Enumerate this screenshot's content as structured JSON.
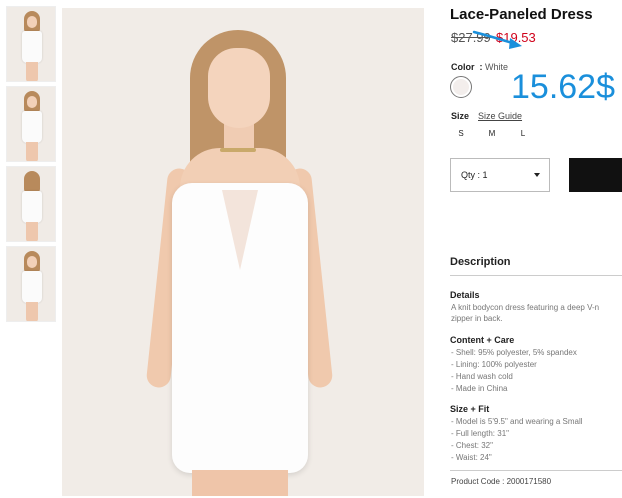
{
  "product": {
    "title": "Lace-Paneled Dress",
    "price_old": "$27.99",
    "price_new": "$19.53",
    "annotation_price": "15.62$",
    "annotation_color": "#1a8fdb"
  },
  "color": {
    "label": "Color",
    "separator": ":",
    "value": "White"
  },
  "size": {
    "label": "Size",
    "guide_link": "Size Guide",
    "options": [
      "S",
      "M",
      "L"
    ]
  },
  "quantity": {
    "label": "Qty : 1"
  },
  "description": {
    "title": "Description",
    "details_heading": "Details",
    "details_lines": [
      "A knit bodycon dress featuring a deep V-n",
      "zipper in back."
    ],
    "content_heading": "Content + Care",
    "content_lines": [
      "- Shell: 95% polyester, 5% spandex",
      "- Lining: 100% polyester",
      "- Hand wash cold",
      "- Made in China"
    ],
    "size_fit_heading": "Size + Fit",
    "size_fit_lines": [
      "- Model is 5'9.5\" and wearing a Small",
      "- Full length: 31\"",
      "- Chest: 32\"",
      "- Waist: 24\""
    ],
    "product_code": "Product Code : 2000171580"
  },
  "thumbnails": [
    {
      "icon": "dress-front-thumbnail"
    },
    {
      "icon": "dress-side-thumbnail"
    },
    {
      "icon": "dress-back-thumbnail"
    },
    {
      "icon": "dress-detail-thumbnail"
    }
  ]
}
